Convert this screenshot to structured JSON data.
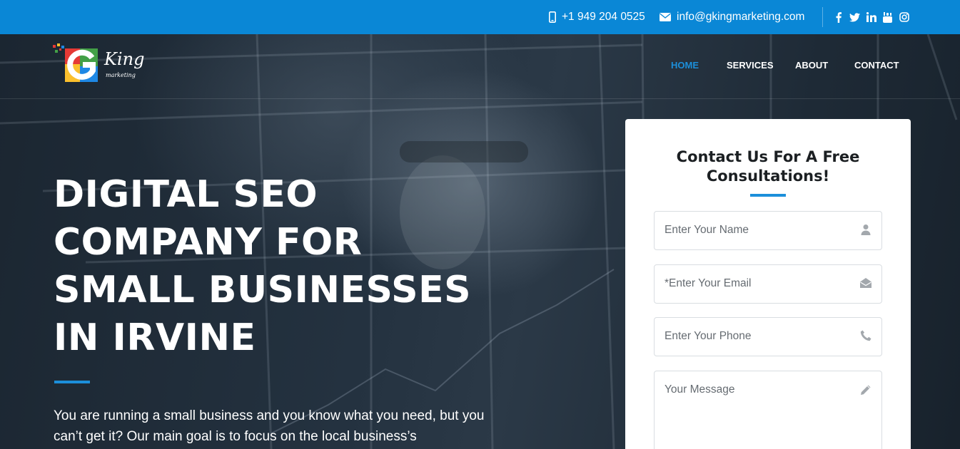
{
  "topbar": {
    "phone": "+1 949 204 0525",
    "email": "info@gkingmarketing.com",
    "socials": [
      "facebook-icon",
      "twitter-icon",
      "linkedin-icon",
      "youtube-icon",
      "instagram-icon"
    ],
    "background": "#0a87d6"
  },
  "logo": {
    "script": "King",
    "sub": "marketing"
  },
  "nav": {
    "items": [
      {
        "label": "HOME",
        "active": true
      },
      {
        "label": "SERVICES",
        "active": false
      },
      {
        "label": "ABOUT",
        "active": false
      },
      {
        "label": "CONTACT",
        "active": false
      }
    ]
  },
  "hero": {
    "headline": [
      "DIGITAL SEO",
      "COMPANY FOR",
      "SMALL BUSINESSES",
      "IN IRVINE"
    ],
    "intro": "You are running a small business and you know what you need, but you can’t get it? Our main goal is to focus on the local business’s"
  },
  "form": {
    "title": "Contact Us For A Free Consultations!",
    "name_placeholder": "Enter Your Name",
    "email_placeholder": "*Enter Your Email",
    "phone_placeholder": "Enter Your Phone",
    "message_placeholder": "Your Message"
  },
  "colors": {
    "accent": "#1c8fda",
    "text_dark": "#1b1f22"
  }
}
